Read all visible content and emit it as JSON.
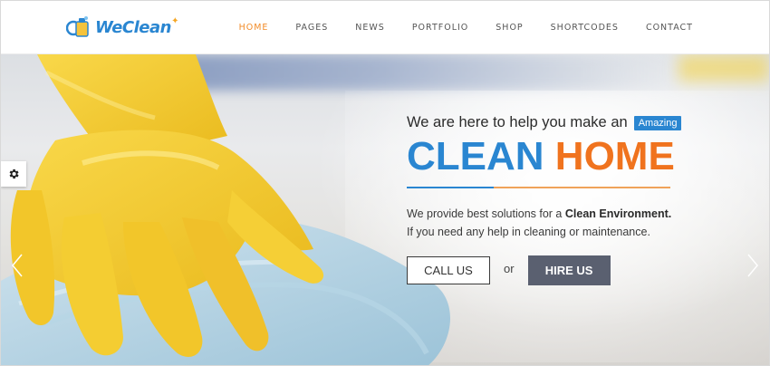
{
  "brand": {
    "logo_text_we": "We",
    "logo_text_clean": "Clean",
    "accent_blue": "#2a86d1",
    "accent_orange": "#f0731e"
  },
  "nav": {
    "items": [
      {
        "label": "HOME",
        "active": true
      },
      {
        "label": "PAGES",
        "active": false
      },
      {
        "label": "NEWS",
        "active": false
      },
      {
        "label": "PORTFOLIO",
        "active": false
      },
      {
        "label": "SHOP",
        "active": false
      },
      {
        "label": "SHORTCODES",
        "active": false
      },
      {
        "label": "CONTACT",
        "active": false
      }
    ]
  },
  "hero": {
    "tagline": "We are here to help you make an",
    "badge": "Amazing",
    "headline_part1": "CLEAN",
    "headline_part2": "HOME",
    "description_line1_prefix": "We provide best solutions for a",
    "description_line1_bold": "Clean Environment.",
    "description_line2": "If you need any help in cleaning or maintenance.",
    "cta_primary": "CALL US",
    "cta_separator": "or",
    "cta_secondary": "HIRE US"
  },
  "icons": {
    "settings": "gear-icon",
    "prev": "chevron-left-icon",
    "next": "chevron-right-icon"
  }
}
